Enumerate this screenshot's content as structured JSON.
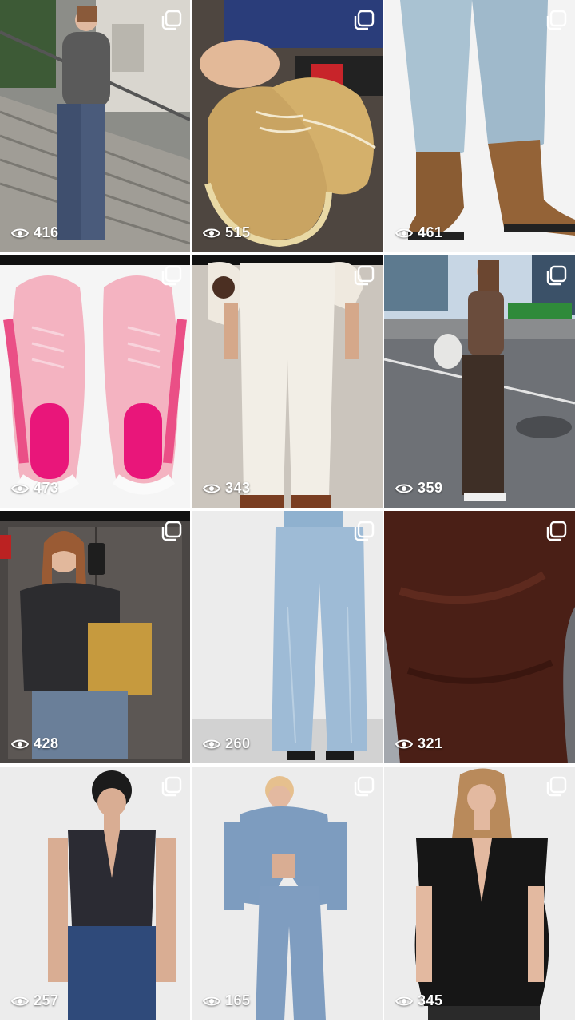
{
  "grid": {
    "tiles": [
      {
        "views": "416",
        "icon": "eye-icon",
        "multi": "multiple-posts-icon",
        "bg": "#8b8e8a",
        "accent": "#3e4a66"
      },
      {
        "views": "515",
        "icon": "eye-icon",
        "multi": "multiple-posts-icon",
        "bg": "#5a4f46",
        "accent": "#c8a562"
      },
      {
        "views": "461",
        "icon": "eye-icon",
        "multi": "multiple-posts-icon",
        "bg": "#f3f3f3",
        "accent": "#8d6136"
      },
      {
        "views": "473",
        "icon": "eye-icon",
        "multi": "multiple-posts-icon",
        "bg": "#f4f4f4",
        "accent": "#f5a6b8"
      },
      {
        "views": "343",
        "icon": "eye-icon",
        "multi": "multiple-posts-icon",
        "bg": "#cfc9c2",
        "accent": "#f1ede4"
      },
      {
        "views": "359",
        "icon": "eye-icon",
        "multi": "multiple-posts-icon",
        "bg": "#6f7276",
        "accent": "#4a3a2e"
      },
      {
        "views": "428",
        "icon": "eye-icon",
        "multi": "multiple-posts-icon",
        "bg": "#4b4846",
        "accent": "#c69a3e"
      },
      {
        "views": "260",
        "icon": "eye-icon",
        "multi": "multiple-posts-icon",
        "bg": "#ececec",
        "accent": "#9fbcd6"
      },
      {
        "views": "321",
        "icon": "eye-icon",
        "multi": "multiple-posts-icon",
        "bg": "#4b2218",
        "accent": "#5a2a1e"
      },
      {
        "views": "257",
        "icon": "eye-icon",
        "multi": "multiple-posts-icon",
        "bg": "#ececec",
        "accent": "#2b2b33"
      },
      {
        "views": "165",
        "icon": "eye-icon",
        "multi": "multiple-posts-icon",
        "bg": "#ececec",
        "accent": "#7d9cbf"
      },
      {
        "views": "345",
        "icon": "eye-icon",
        "multi": "multiple-posts-icon",
        "bg": "#ececec",
        "accent": "#141414"
      }
    ]
  }
}
